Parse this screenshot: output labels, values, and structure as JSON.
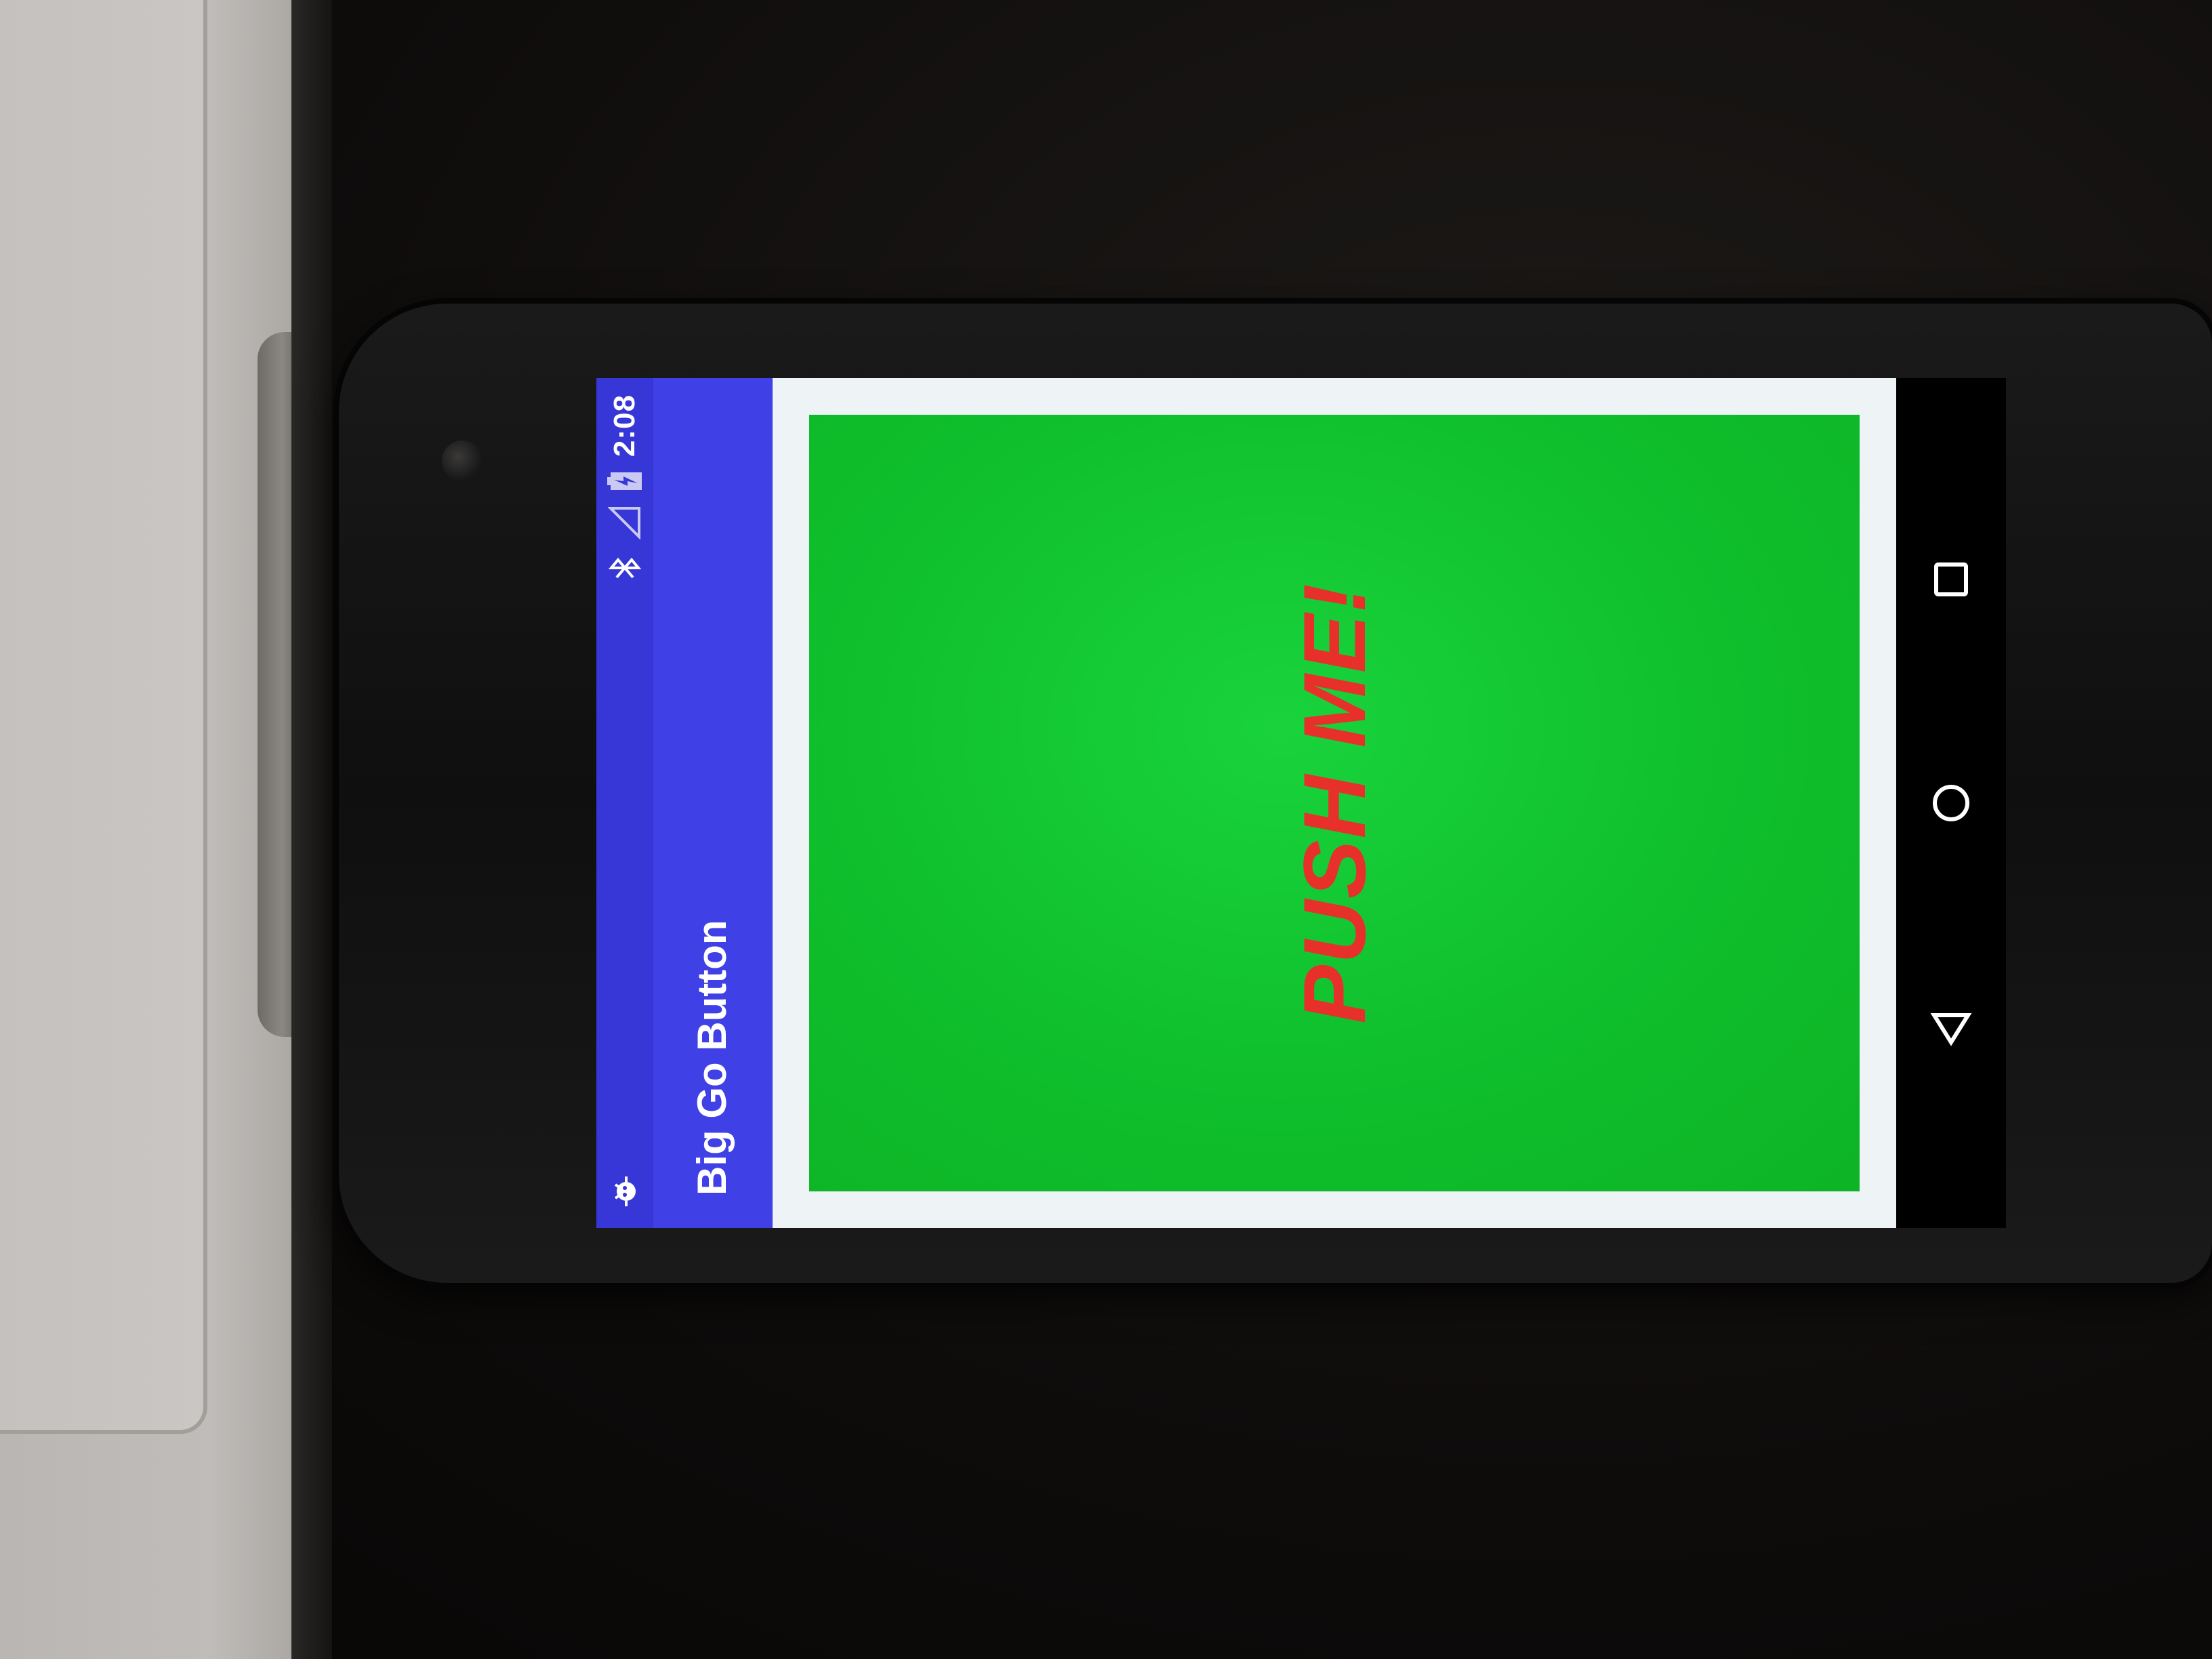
{
  "status_bar": {
    "time": "2:08",
    "icons": [
      "android-debug-icon",
      "bluetooth-icon",
      "signal-icon",
      "battery-charging-icon"
    ]
  },
  "app_bar": {
    "title": "Big Go Button"
  },
  "main": {
    "button_label": "PUSH ME!",
    "button_color": "#12c832",
    "label_color": "#e8302a"
  },
  "nav_bar": {
    "icons": [
      "back-icon",
      "home-icon",
      "recents-icon"
    ]
  },
  "colors": {
    "status_bar": "#3637d6",
    "app_bar": "#3f41e6",
    "background": "#eef4f6"
  }
}
